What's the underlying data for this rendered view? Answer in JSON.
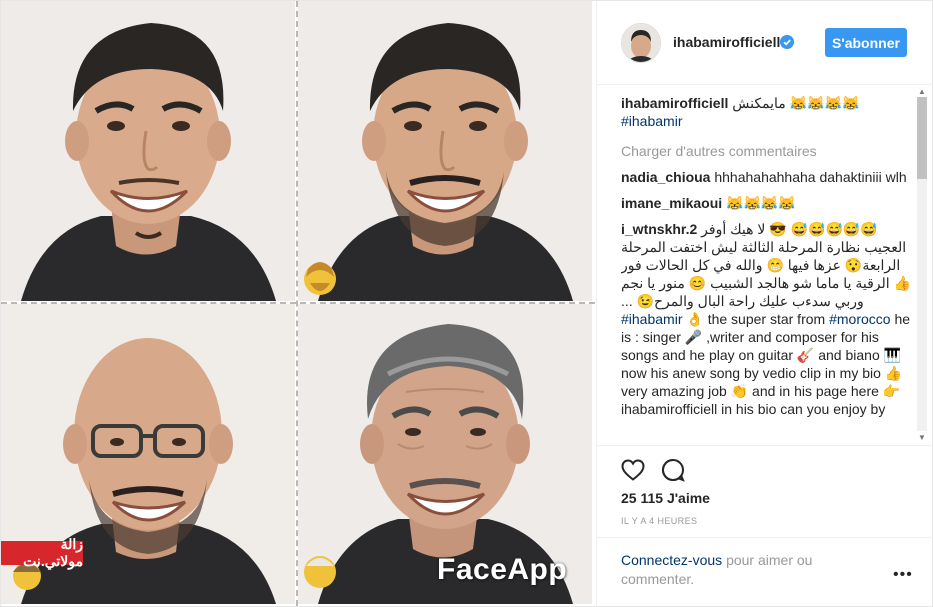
{
  "media": {
    "watermark": "FaceApp",
    "site_badge": "زالة مولاتي.نت"
  },
  "header": {
    "username": "ihabamirofficiell",
    "follow_label": "S'abonner"
  },
  "caption": {
    "username": "ihabamirofficiell",
    "text": "مايمكنش 😹😹😹😹",
    "hashtag": "#ihabamir"
  },
  "load_more": "Charger d'autres commentaires",
  "comments": [
    {
      "user": "nadia_chioua",
      "text": "hhhahahahhaha dahaktiniii wlh"
    },
    {
      "user": "imane_mikaoui",
      "text": "😹😹😹😹"
    },
    {
      "user": "i_wtnskhr.2",
      "text_rtl": "😅😅😅😅😅 😎 لا هيك أوفر العجيب نظارة المرحلة الثالثة ليش اختفت المرحلة الرابعة😯 عزها فيها 😁 والله في كل الحالات فور 👍 الرقية يا ماما شو هالجد الشبيب 😊 منور يا نجم وربي سدءب عليك راحة البال والمرح😉 ...",
      "hashtag1": "#ihabamir",
      "text_en1": "👌 the super star from",
      "hashtag2": "#morocco",
      "text_en2": "he is : singer 🎤 ,writer and composer for his songs and he play on guitar 🎸 and biano 🎹 now his anew song by vedio clip in my bio 👍 very amazing job 👏 and in his page here 👉 ihabamirofficiell in his bio can you enjoy by"
    }
  ],
  "likes": "25 115 J'aime",
  "time": "IL Y A 4 HEURES",
  "login": {
    "link": "Connectez-vous",
    "rest": "pour aimer ou commenter."
  },
  "colors": {
    "follow": "#3897f0",
    "link": "#003569",
    "muted": "#999999",
    "badge": "#d7262c"
  }
}
